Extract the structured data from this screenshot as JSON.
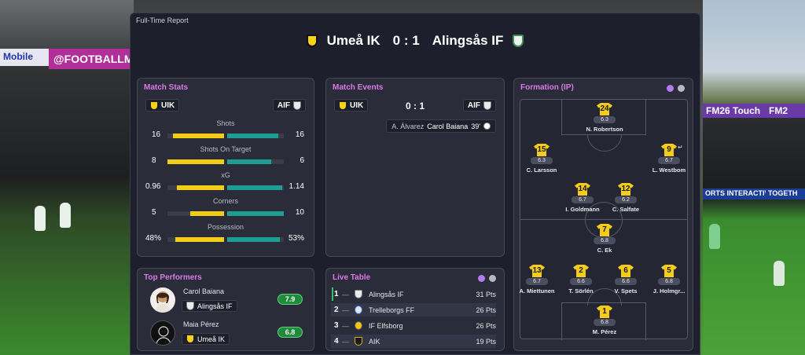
{
  "background": {
    "banners": [
      "Mobile",
      "@FOOTBALLMA",
      "FM26 Touch",
      "FM2",
      "ORTS INTERACTIVE",
      "TOGETH"
    ]
  },
  "report": {
    "label": "Full-Time Report",
    "home_team": "Umeå IK",
    "away_team": "Alingsås IF",
    "score": "0 : 1"
  },
  "match_stats": {
    "title": "Match Stats",
    "home_abbr": "UIK",
    "away_abbr": "AIF",
    "rows": [
      {
        "label": "Shots",
        "home": "16",
        "away": "16",
        "home_share": 0.5
      },
      {
        "label": "Shots On Target",
        "home": "8",
        "away": "6",
        "home_share": 0.57
      },
      {
        "label": "xG",
        "home": "0.96",
        "away": "1.14",
        "home_share": 0.46
      },
      {
        "label": "Corners",
        "home": "5",
        "away": "10",
        "home_share": 0.33
      },
      {
        "label": "Possession",
        "home": "48%",
        "away": "53%",
        "home_share": 0.48
      }
    ]
  },
  "match_events": {
    "title": "Match Events",
    "home_abbr": "UIK",
    "away_abbr": "AIF",
    "score": "0 : 1",
    "event": {
      "assist": "A. Álvarez",
      "scorer": "Carol Baiana",
      "minute": "39'"
    }
  },
  "formation": {
    "title": "Formation (IP)",
    "players": [
      {
        "number": "24",
        "rating": "6.3",
        "name": "N. Robertson"
      },
      {
        "number": "15",
        "rating": "6.3",
        "name": "C. Larsson"
      },
      {
        "number": "9",
        "rating": "6.7",
        "name": "L. Westbom"
      },
      {
        "number": "14",
        "rating": "6.7",
        "name": "I. Goldmann"
      },
      {
        "number": "12",
        "rating": "6.2",
        "name": "C. Salfate"
      },
      {
        "number": "7",
        "rating": "6.8",
        "name": "C. Ek"
      },
      {
        "number": "13",
        "rating": "6.7",
        "name": "A. Miettunen"
      },
      {
        "number": "2",
        "rating": "6.6",
        "name": "T. Sörlén"
      },
      {
        "number": "6",
        "rating": "6.6",
        "name": "V. Spets"
      },
      {
        "number": "5",
        "rating": "6.8",
        "name": "J. Holmgr..."
      },
      {
        "number": "1",
        "rating": "6.8",
        "name": "M. Pérez"
      }
    ]
  },
  "top_performers": {
    "title": "Top Performers",
    "items": [
      {
        "name": "Carol Baiana",
        "team": "Alingsås IF",
        "rating": "7.9"
      },
      {
        "name": "Maia Pérez",
        "team": "Umeå IK",
        "rating": "6.8"
      }
    ]
  },
  "live_table": {
    "title": "Live Table",
    "rows": [
      {
        "pos": "1",
        "trend": "—",
        "team": "Alingsås IF",
        "pts": "31 Pts"
      },
      {
        "pos": "2",
        "trend": "—",
        "team": "Trelleborgs FF",
        "pts": "26 Pts"
      },
      {
        "pos": "3",
        "trend": "—",
        "team": "IF Elfsborg",
        "pts": "26 Pts"
      },
      {
        "pos": "4",
        "trend": "—",
        "team": "AIK",
        "pts": "19 Pts"
      }
    ]
  },
  "colors": {
    "home": "#f3cc17",
    "away": "#1d9d93",
    "accent": "#d97be8"
  }
}
